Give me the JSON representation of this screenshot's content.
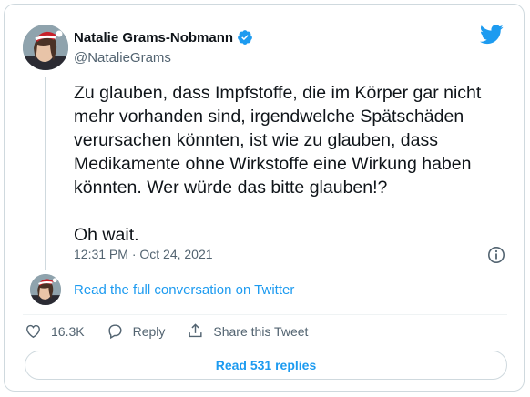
{
  "author": {
    "display_name": "Natalie Grams-Nobmann",
    "handle": "@NatalieGrams",
    "verified": true
  },
  "tweet": {
    "lines": [
      "Zu glauben, dass Impfstoffe, die im Körper gar nicht",
      "mehr vorhanden sind, irgendwelche Spätschäden",
      "verursachen könnten, ist wie zu glauben, dass",
      "Medikamente ohne Wirkstoffe eine Wirkung haben",
      "könnten. Wer würde das bitte glauben!?"
    ],
    "closing": "Oh wait.",
    "timestamp": "12:31 PM · Oct 24, 2021"
  },
  "conversation": {
    "link_label": "Read the full conversation on Twitter"
  },
  "actions": {
    "like_count": "16.3K",
    "reply_label": "Reply",
    "share_label": "Share this Tweet"
  },
  "replies_button": {
    "label": "Read 531 replies"
  },
  "colors": {
    "accent": "#1d9bf0",
    "text": "#0f1419",
    "muted": "#536471",
    "border": "#cfd9de"
  },
  "icons": [
    "verified-badge-icon",
    "twitter-bird-icon",
    "info-icon",
    "heart-icon",
    "reply-bubble-icon",
    "share-icon"
  ]
}
